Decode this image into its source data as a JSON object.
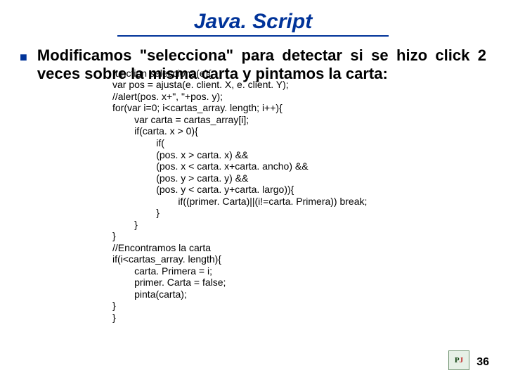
{
  "title": "Java. Script",
  "bullet_glyph": "■",
  "paragraph": "Modificamos \"selecciona\" para detectar si se hizo click 2 veces sobre la misma carta y pintamos la carta:",
  "code": "function selecciona(e){\nvar pos = ajusta(e. client. X, e. client. Y);\n//alert(pos. x+\", \"+pos. y);\nfor(var i=0; i<cartas_array. length; i++){\n        var carta = cartas_array[i];\n        if(carta. x > 0){\n                if(\n                (pos. x > carta. x) &&\n                (pos. x < carta. x+carta. ancho) &&\n                (pos. y > carta. y) &&\n                (pos. y < carta. y+carta. largo)){\n                        if((primer. Carta)||(i!=carta. Primera)) break;\n                }\n        }\n}\n//Encontramos la carta\nif(i<cartas_array. length){\n        carta. Primera = i;\n        primer. Carta = false;\n        pinta(carta);\n}\n}",
  "page_number": "36",
  "logo_text_p": "P",
  "logo_text_j": "J"
}
